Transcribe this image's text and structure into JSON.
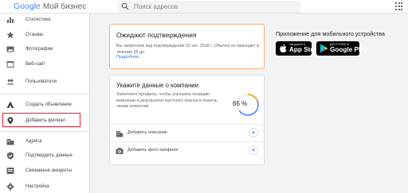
{
  "header": {
    "logo": "Google",
    "product": "Мой бизнес",
    "search_placeholder": "Поиск адресов"
  },
  "sidebar": {
    "items": [
      {
        "label": "Статистика",
        "icon": "bar-chart-icon"
      },
      {
        "label": "Отзывы",
        "icon": "star-icon"
      },
      {
        "label": "Фотографии",
        "icon": "photo-icon"
      },
      {
        "label": "Веб-сайт",
        "icon": "website-icon"
      },
      {
        "label": "Пользователи",
        "icon": "users-icon"
      },
      {
        "label": "Создать объявление",
        "icon": "ads-icon"
      },
      {
        "label": "Добавить филиал",
        "icon": "location-pin-icon"
      },
      {
        "label": "Адреса",
        "icon": "buildings-icon"
      },
      {
        "label": "Подтвердить данные",
        "icon": "shield-check-icon"
      },
      {
        "label": "Связанные аккаунты",
        "icon": "linked-accounts-icon"
      },
      {
        "label": "Настройка",
        "icon": "gear-icon"
      }
    ],
    "highlight_color": "#e4202a"
  },
  "pending": {
    "title": "Ожидают подтверждения",
    "text": "Вы запросили код подтверждения 23 окт. 2018 г. Обычно он приходит в течение 26 дн.",
    "link": "Подробнее..."
  },
  "mobile": {
    "title": "Приложение для мобильного устройства",
    "apple_small": "Загрузите в",
    "apple_big": "App Store",
    "google_small": "ДОСТУПНО В",
    "google_big": "Google Play"
  },
  "company": {
    "title": "Укажите данные о компании",
    "text": "Заполните профиль, чтобы улучшить позицию компании в результатах местного поиска и помочь своим клиентам.",
    "progress_label": "65 %",
    "progress_value": 0.65,
    "rows": [
      {
        "label": "Добавить описание",
        "icon": "storefront-icon"
      },
      {
        "label": "Добавить фото профиля",
        "icon": "camera-icon"
      }
    ]
  },
  "colors": {
    "accent": "#1a73e8",
    "pending_border": "#f4b183",
    "progress_orange": "#f29900",
    "progress_blue": "#4285f4"
  }
}
